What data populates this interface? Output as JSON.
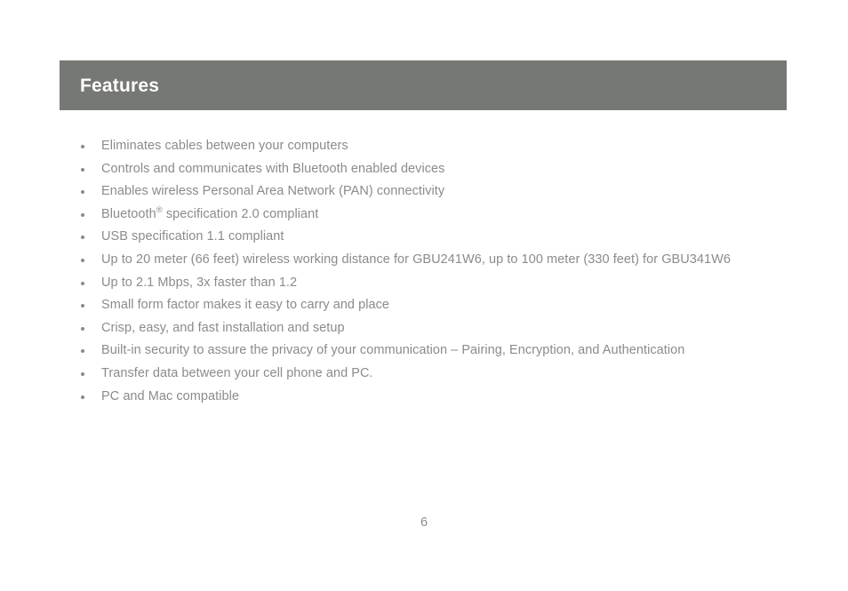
{
  "document": {
    "background_color": "#ffffff",
    "section": {
      "header_bar_color": "#767874",
      "header_title": "Features",
      "title_color": "#ffffff"
    },
    "body_text_color": "#8b8b8b",
    "features": [
      {
        "text": "Eliminates cables between your computers"
      },
      {
        "text": "Controls and communicates with Bluetooth enabled devices"
      },
      {
        "text": "Enables wireless Personal Area Network (PAN) connectivity"
      },
      {
        "text_before": "Bluetooth",
        "superscript": "®",
        "text_after": " specification 2.0 compliant"
      },
      {
        "text": "USB specification 1.1 compliant"
      },
      {
        "text": "Up to 20 meter (66 feet) wireless working distance for GBU241W6, up to 100 meter (330 feet) for GBU341W6"
      },
      {
        "text": "Up to 2.1 Mbps, 3x faster than 1.2"
      },
      {
        "text": "Small form factor makes it easy to carry and place"
      },
      {
        "text": "Crisp, easy, and fast installation and setup"
      },
      {
        "text": "Built-in security to assure the privacy of your communication – Pairing, Encryption, and Authentication"
      },
      {
        "text": "Transfer data between your cell phone and PC."
      },
      {
        "text": "PC and Mac compatible"
      }
    ],
    "page_number": "6"
  }
}
